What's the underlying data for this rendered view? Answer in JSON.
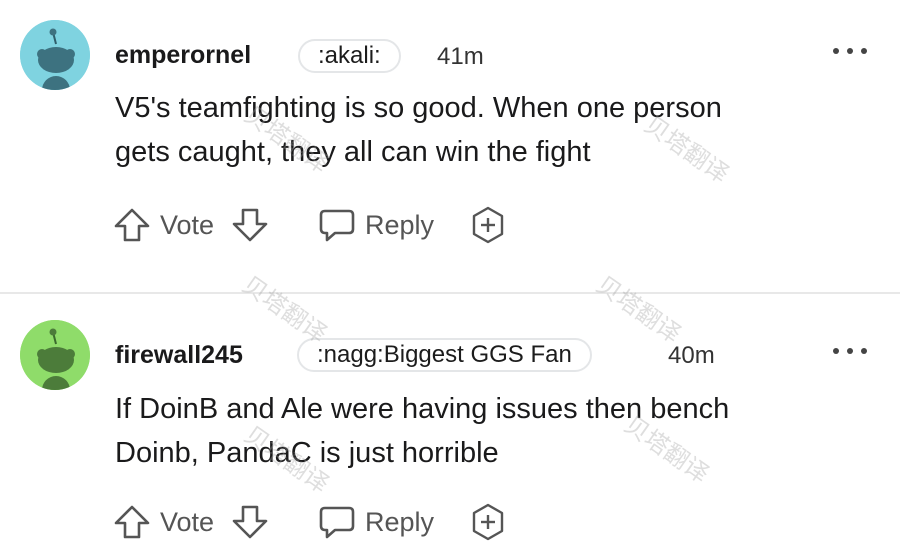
{
  "comments": [
    {
      "username": "emperornel",
      "flair": ":akali:",
      "time": "41m",
      "body_line1": "V5's teamfighting is so good. When one person",
      "body_line2": "gets caught, they all can win the fight",
      "avatar_color": "#7fd3e0",
      "actions": {
        "vote": "Vote",
        "reply": "Reply"
      }
    },
    {
      "username": "firewall245",
      "flair": ":nagg:Biggest GGS Fan",
      "time": "40m",
      "body_line1": "If DoinB and Ale were having issues then bench",
      "body_line2": "Doinb, PandaC is just horrible",
      "avatar_color": "#8fdc6a",
      "actions": {
        "vote": "Vote",
        "reply": "Reply"
      }
    }
  ],
  "watermark": "贝塔翻译",
  "colors": {
    "icon": "#555555",
    "divider": "#e8e8e8"
  }
}
